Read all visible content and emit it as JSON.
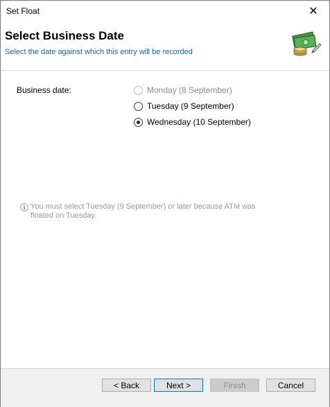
{
  "window": {
    "title": "Set Float"
  },
  "header": {
    "title": "Select Business Date",
    "subtitle": "Select the date against which this entry will be recorded",
    "icon": "money-icon"
  },
  "form": {
    "label": "Business date:",
    "options": [
      {
        "label": "Monday (8 September)",
        "state": "disabled"
      },
      {
        "label": "Tuesday (9 September)",
        "state": "enabled"
      },
      {
        "label": "Wednesday (10 September)",
        "state": "checked"
      }
    ]
  },
  "info": {
    "text": "You must select Tuesday (9 September) or later because ATM was floated on Tuesday."
  },
  "footer": {
    "back": "< Back",
    "next": "Next >",
    "finish": "Finish",
    "cancel": "Cancel"
  },
  "colors": {
    "subtitle": "#1a5fb4",
    "accent": "#0078d7"
  }
}
